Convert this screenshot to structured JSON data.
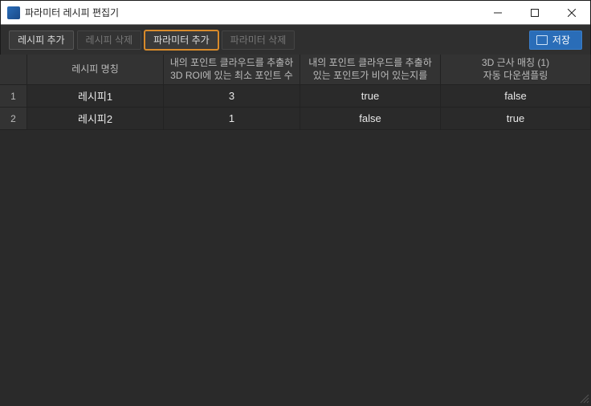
{
  "window": {
    "title": "파라미터 레시피 편집기"
  },
  "toolbar": {
    "add_recipe": "레시피 추가",
    "delete_recipe": "레시피 삭제",
    "add_param": "파라미터 추가",
    "delete_param": "파라미터 삭제",
    "save": "저장"
  },
  "table": {
    "headers": {
      "name": "레시피 명칭",
      "col2_line1": "내의 포인트 클라우드를 추출하",
      "col2_line2": "3D ROI에 있는 최소 포인트 수",
      "col3_line1": "내의 포인트 클라우드를 추출하",
      "col3_line2": "있는 포인트가 비어 있는지를",
      "col4_line1": "3D 근사 매칭 (1)",
      "col4_line2": "자동 다운샘플링"
    },
    "rows": [
      {
        "idx": "1",
        "name": "레시피1",
        "c2": "3",
        "c3": "true",
        "c4": "false"
      },
      {
        "idx": "2",
        "name": "레시피2",
        "c2": "1",
        "c3": "false",
        "c4": "true"
      }
    ]
  }
}
